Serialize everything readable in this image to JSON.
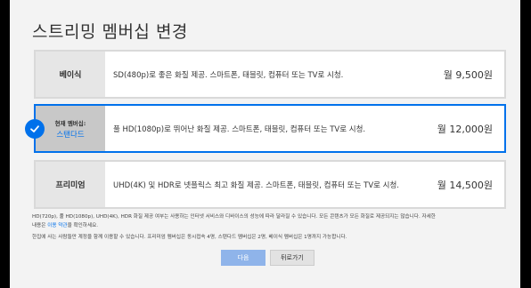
{
  "title": "스트리밍 멤버십 변경",
  "plans": [
    {
      "name": "베이식",
      "desc": "SD(480p)로 좋은 화질 제공. 스마트폰, 태블릿, 컴퓨터 또는 TV로 시청.",
      "price": "월 9,500원"
    },
    {
      "current_label": "현재 멤버십:",
      "name": "스탠다드",
      "desc": "풀 HD(1080p)로 뛰어난 화질 제공. 스마트폰, 태블릿, 컴퓨터 또는 TV로 시청.",
      "price": "월 12,000원"
    },
    {
      "name": "프리미엄",
      "desc": "UHD(4K) 및 HDR로 넷플릭스 최고 화질 제공. 스마트폰, 태블릿, 컴퓨터 또는 TV로 시청.",
      "price": "월 14,500원"
    }
  ],
  "notes": {
    "line1": "HD(720p), 풀 HD(1080p), UHD(4K), HDR 화질 제공 여부는 사용하는 인터넷 서비스와 디바이스의 성능에 따라 달라질 수 있습니다. 모든 콘텐츠가 모든 화질로 제공되지는 않습니다. 자세한",
    "line2_pre": "내용은 ",
    "link": "이용 약관",
    "line2_post": "을 확인하세요.",
    "line3": "한집에 사는 사람들만 계정을 함께 이용할 수 있습니다. 프리미엄 멤버십은 동시접속 4명, 스탠다드 멤버십은 2명, 베이식 멤버십은 1명까지 가능합니다."
  },
  "buttons": {
    "next": "다음",
    "back": "뒤로가기"
  },
  "colors": {
    "accent": "#0071eb",
    "disabled_button": "#8fb4ea"
  },
  "icons": {
    "selected": "checkmark-icon"
  }
}
